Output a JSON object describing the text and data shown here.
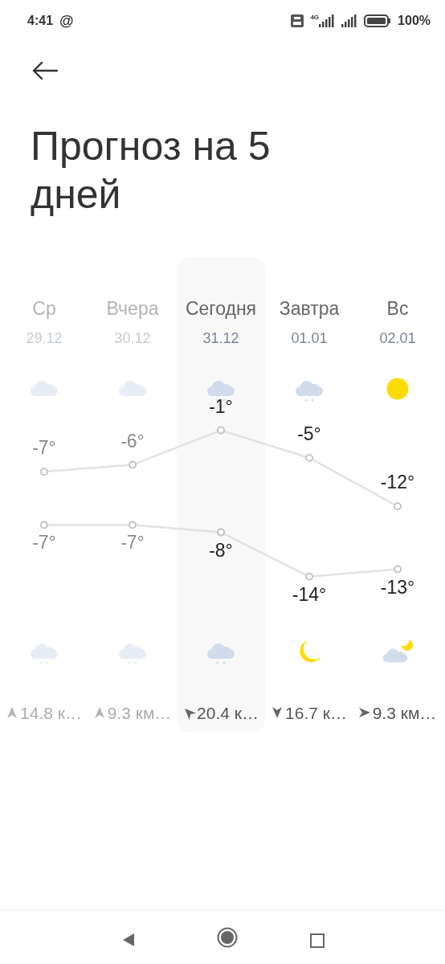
{
  "status_bar": {
    "time": "4:41",
    "notification": "@",
    "network": "4G",
    "battery_text": "100%"
  },
  "title": "Прогноз на 5 дней",
  "days": [
    {
      "label": "Ср",
      "date": "29.12",
      "selected": false,
      "past": true,
      "day_icon": {
        "kind": "cloud"
      },
      "high": "-7°",
      "low": "-7°",
      "night_icon": {
        "kind": "snow"
      },
      "wind_arrow": {
        "kind": "north"
      },
      "wind": "14.8 к…"
    },
    {
      "label": "Вчера",
      "date": "30.12",
      "selected": false,
      "past": true,
      "day_icon": {
        "kind": "cloud"
      },
      "high": "-6°",
      "low": "-7°",
      "night_icon": {
        "kind": "snow"
      },
      "wind_arrow": {
        "kind": "north"
      },
      "wind": "9.3 км…"
    },
    {
      "label": "Сегодня",
      "date": "31.12",
      "selected": true,
      "past": false,
      "day_icon": {
        "kind": "snow"
      },
      "high": "-1°",
      "low": "-8°",
      "night_icon": {
        "kind": "snow"
      },
      "wind_arrow": {
        "kind": "northwest"
      },
      "wind": "20.4 к…"
    },
    {
      "label": "Завтра",
      "date": "01.01",
      "selected": false,
      "past": false,
      "day_icon": {
        "kind": "snow"
      },
      "high": "-5°",
      "low": "-14°",
      "night_icon": {
        "kind": "moon"
      },
      "wind_arrow": {
        "kind": "south"
      },
      "wind": "16.7 к…"
    },
    {
      "label": "Вс",
      "date": "02.01",
      "selected": false,
      "past": false,
      "day_icon": {
        "kind": "sun"
      },
      "high": "-12°",
      "low": "-13°",
      "night_icon": {
        "kind": "cloudmoon"
      },
      "wind_arrow": {
        "kind": "east"
      },
      "wind": "9.3 км…"
    }
  ]
}
